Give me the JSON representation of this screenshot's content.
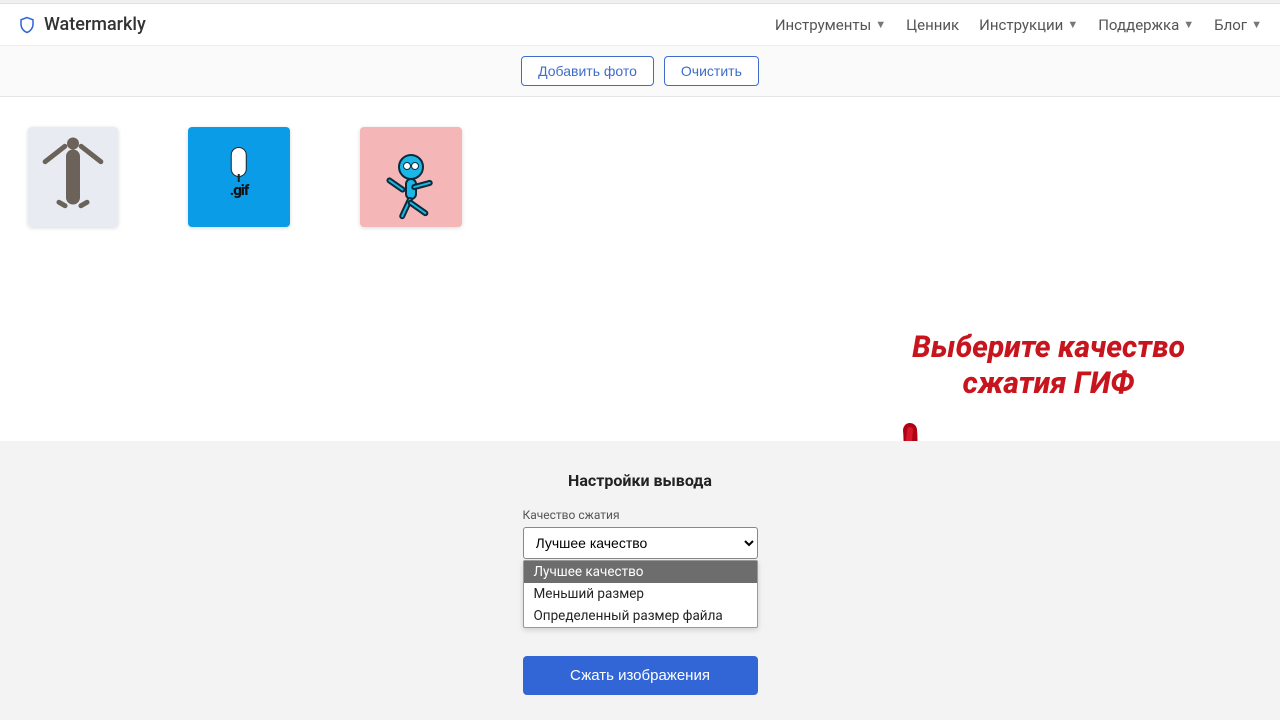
{
  "brand": "Watermarkly",
  "nav": {
    "tools": "Инструменты",
    "pricing": "Ценник",
    "instructions": "Инструкции",
    "support": "Поддержка",
    "blog": "Блог"
  },
  "actions": {
    "add_photo": "Добавить фото",
    "clear": "Очистить"
  },
  "thumbs": {
    "gif_label": ".gif"
  },
  "callout": {
    "line1": "Выберите качество",
    "line2": "сжатия ГИФ"
  },
  "panel": {
    "title": "Настройки вывода",
    "quality_label": "Качество сжатия",
    "selected": "Лучшее качество",
    "options": [
      "Лучшее качество",
      "Меньший размер",
      "Определенный размер файла"
    ],
    "submit": "Сжать изображения"
  }
}
